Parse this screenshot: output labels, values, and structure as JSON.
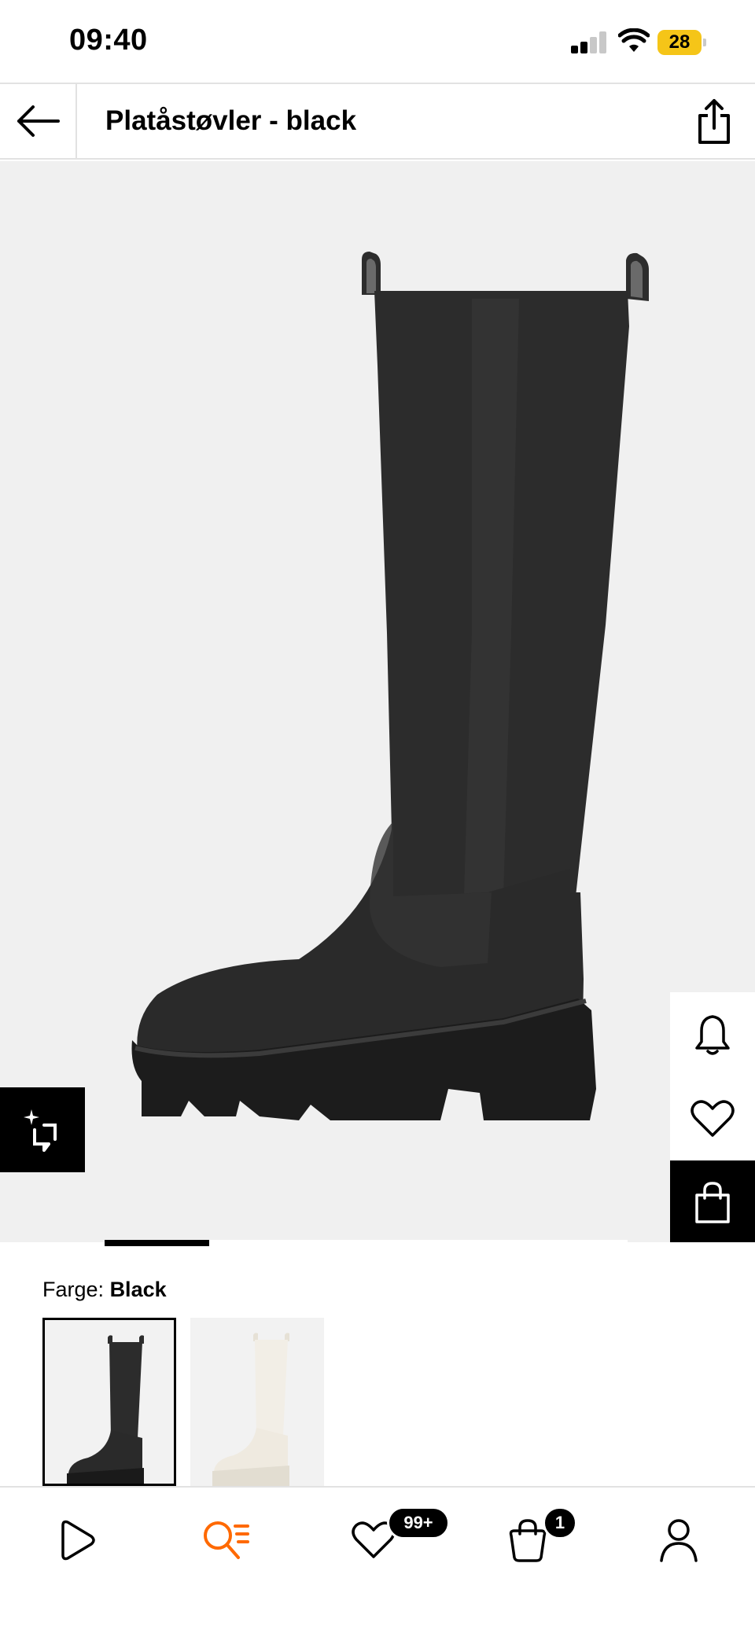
{
  "status_bar": {
    "time": "09:40",
    "battery_level": "28",
    "battery_color": "#f5c518",
    "icons": [
      "cellular-signal-icon",
      "wifi-icon",
      "battery-charging-icon"
    ]
  },
  "header": {
    "title": "Platåstøvler - black",
    "back_icon": "arrow-left-icon",
    "share_icon": "share-icon"
  },
  "gallery": {
    "current_image": 1,
    "image_count": 5,
    "side_actions": [
      "bell-icon",
      "heart-icon",
      "shopping-bag-icon"
    ],
    "ai_button_icon": "sparkle-crop-icon"
  },
  "color_selector": {
    "label": "Farge:",
    "selected_value": "Black",
    "options": [
      {
        "color": "black",
        "selected": true
      },
      {
        "color": "off-white",
        "selected": false
      }
    ]
  },
  "bottom_nav": {
    "items": [
      {
        "icon": "play-home-icon",
        "active": false
      },
      {
        "icon": "search-list-icon",
        "active": true
      },
      {
        "icon": "heart-icon",
        "badge": "99+",
        "active": false
      },
      {
        "icon": "bag-icon",
        "badge": "1",
        "active": false
      },
      {
        "icon": "profile-icon",
        "active": false
      }
    ],
    "active_color": "#ff6900"
  }
}
